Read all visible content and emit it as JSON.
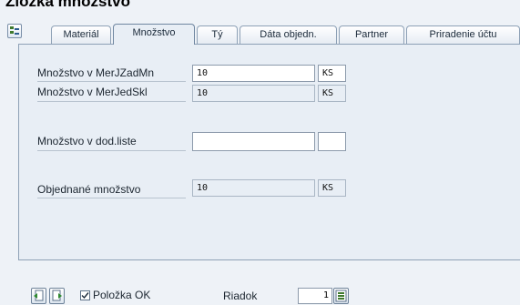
{
  "screen": {
    "title": "Zložka množstvo"
  },
  "tabs": [
    {
      "label": "Materiál",
      "active": false
    },
    {
      "label": "Množstvo",
      "active": true
    },
    {
      "label": "Tý",
      "active": false
    },
    {
      "label": "Dáta objedn.",
      "active": false
    },
    {
      "label": "Partner",
      "active": false
    },
    {
      "label": "Priradenie účtu",
      "active": false
    }
  ],
  "fields": {
    "qty_order_unit": {
      "label": "Množstvo v MerJZadMn",
      "value": "10",
      "unit": "KS"
    },
    "qty_stock_unit": {
      "label": "Množstvo v MerJedSkl",
      "value": "10",
      "unit": "KS"
    },
    "qty_delivery_note": {
      "label": "Množstvo v dod.liste",
      "value": "",
      "unit": ""
    },
    "qty_ordered": {
      "label": "Objednané množstvo",
      "value": "10",
      "unit": "KS"
    }
  },
  "footer": {
    "item_ok_label": "Položka OK",
    "item_ok_checked": true,
    "row_label": "Riadok",
    "row_value": "1"
  },
  "icons": {
    "tree_toggle": "tree-toggle-icon",
    "prev_item": "previous-item-icon",
    "next_item": "next-item-icon",
    "row_select": "row-select-icon"
  },
  "colors": {
    "panel_bg": "#e8eef5",
    "page_bg": "#eef2f7",
    "border": "#8ea1b6"
  }
}
